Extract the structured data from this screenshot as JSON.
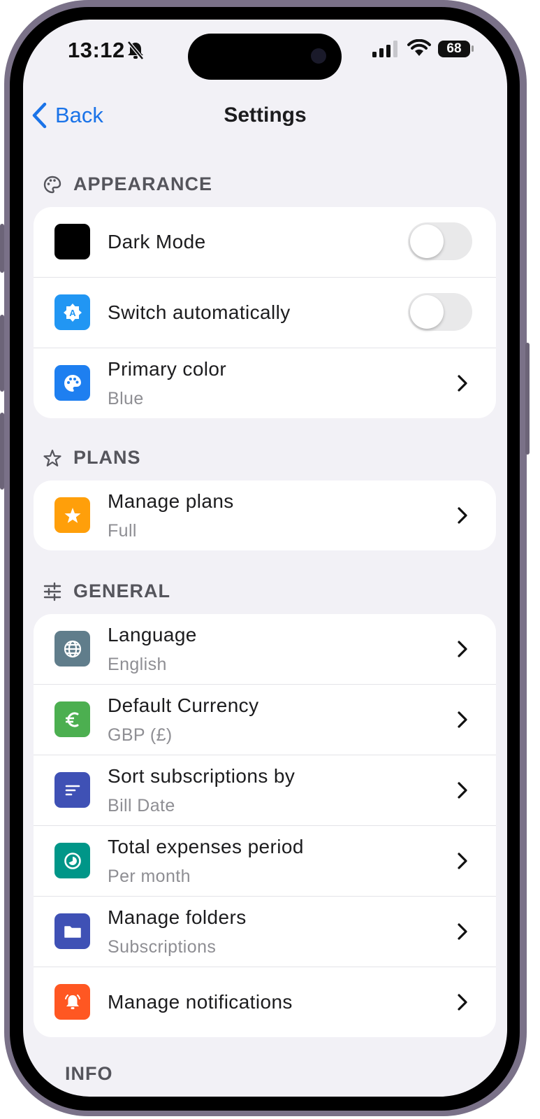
{
  "status_bar": {
    "time": "13:12",
    "battery": "68"
  },
  "nav": {
    "back_label": "Back",
    "title": "Settings"
  },
  "appearance": {
    "header": "APPEARANCE",
    "dark_mode": {
      "label": "Dark Mode",
      "on": false
    },
    "switch_auto": {
      "label": "Switch automatically",
      "on": false
    },
    "primary_color": {
      "label": "Primary color",
      "value": "Blue"
    }
  },
  "plans": {
    "header": "PLANS",
    "manage_plans": {
      "label": "Manage plans",
      "value": "Full"
    }
  },
  "general": {
    "header": "GENERAL",
    "language": {
      "label": "Language",
      "value": "English"
    },
    "currency": {
      "label": "Default Currency",
      "value": "GBP (£)"
    },
    "sort": {
      "label": "Sort subscriptions by",
      "value": "Bill Date"
    },
    "period": {
      "label": "Total expenses period",
      "value": "Per month"
    },
    "folders": {
      "label": "Manage folders",
      "value": "Subscriptions"
    },
    "notifications": {
      "label": "Manage notifications"
    }
  },
  "info": {
    "header": "INFO"
  },
  "colors": {
    "accent": "#1a73e8",
    "dark_mode_icon": "#000000",
    "switch_auto_icon": "#2196f3",
    "primary_color_icon": "#1e7ff0",
    "plans_icon": "#ff9f0a",
    "language_icon": "#607d8b",
    "currency_icon": "#4caf50",
    "sort_icon": "#3f51b5",
    "period_icon": "#009688",
    "folders_icon": "#3f51b5",
    "notifications_icon": "#ff5722"
  }
}
